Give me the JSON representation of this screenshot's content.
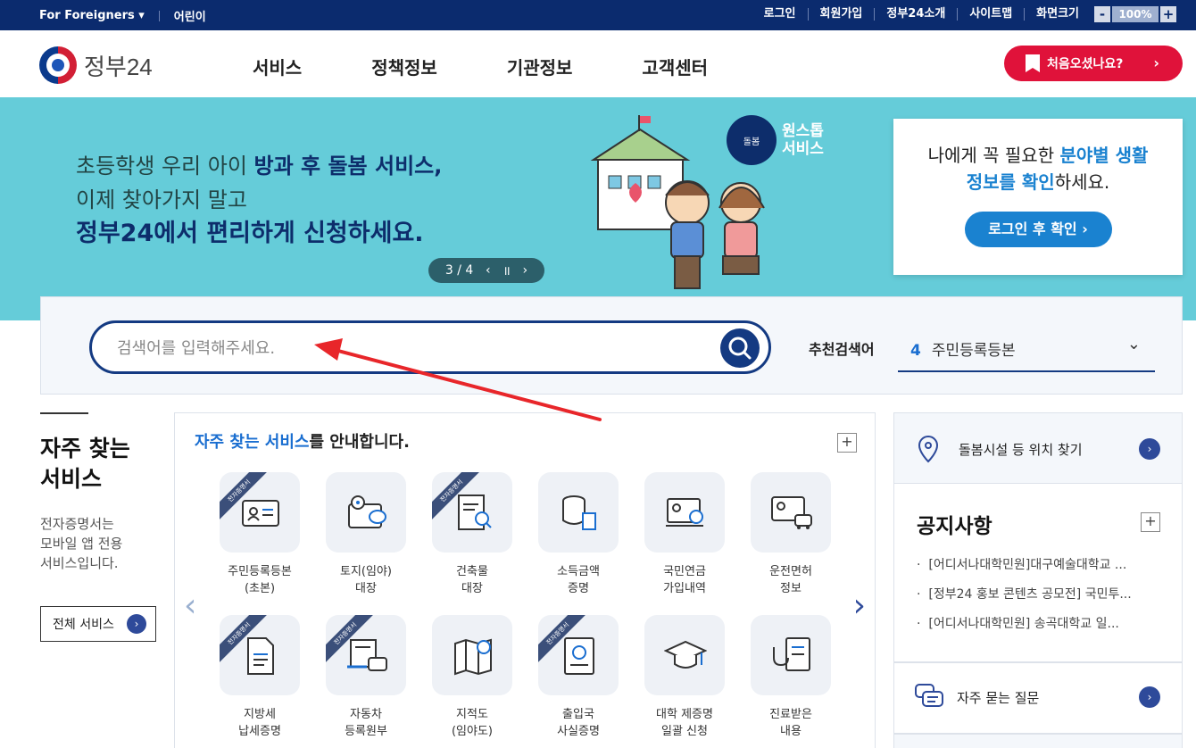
{
  "topbar": {
    "foreigners": "For Foreigners ▾",
    "kids": "어린이",
    "links": [
      "로그인",
      "회원가입",
      "정부24소개",
      "사이트맵",
      "화면크기"
    ],
    "zoom_minus": "-",
    "zoom": "100%",
    "zoom_plus": "+"
  },
  "header": {
    "logo": "정부24",
    "nav": [
      "서비스",
      "정책정보",
      "기관정보",
      "고객센터"
    ],
    "first_visit": "처음오셨나요?"
  },
  "banner": {
    "line1_plain": "초등학생 우리 아이 ",
    "line1_bold": "방과 후 돌봄 서비스,",
    "line2": "이제 찾아가지 말고",
    "line3": "정부24에서 편리하게 신청하세요.",
    "pager": "3 / 4",
    "onestop_badge": "돌봄",
    "onestop_title1": "원스톱",
    "onestop_title2": "서비스"
  },
  "infobox": {
    "text1_plain": "나에게 꼭 필요한 ",
    "text1_hl": "분야별 생활",
    "text2_hl": "정보를 확인",
    "text2_plain": "하세요.",
    "button": "로그인 후 확인 ›"
  },
  "search": {
    "placeholder": "검색어를 입력해주세요.",
    "rec_label": "추천검색어",
    "rec_num": "4",
    "rec_value": "주민등록등본"
  },
  "left": {
    "title1": "자주 찾는",
    "title2": "서비스",
    "desc1": "전자증명서는",
    "desc2": "모바일 앱 전용",
    "desc3": "서비스입니다.",
    "all_button": "전체 서비스"
  },
  "services": {
    "title_hl": "자주 찾는 서비스",
    "title_rest": "를 안내합니다.",
    "ribbon": "전자증명서",
    "items": [
      {
        "l1": "주민등록등본",
        "l2": "(초본)"
      },
      {
        "l1": "토지(임야)",
        "l2": "대장"
      },
      {
        "l1": "건축물",
        "l2": "대장"
      },
      {
        "l1": "소득금액",
        "l2": "증명"
      },
      {
        "l1": "국민연금",
        "l2": "가입내역"
      },
      {
        "l1": "운전면허",
        "l2": "정보"
      },
      {
        "l1": "지방세",
        "l2": "납세증명"
      },
      {
        "l1": "자동차",
        "l2": "등록원부"
      },
      {
        "l1": "지적도",
        "l2": "(임야도)"
      },
      {
        "l1": "출입국",
        "l2": "사실증명"
      },
      {
        "l1": "대학 제증명",
        "l2": "일괄 신청"
      },
      {
        "l1": "진료받은",
        "l2": "내용"
      }
    ]
  },
  "right": {
    "care": "돌봄시설 등 위치 찾기",
    "notice_title": "공지사항",
    "notices": [
      "[어디서나대학민원]대구예술대학교 ...",
      "[정부24 홍보 콘텐츠 공모전] 국민투...",
      "[어디서나대학민원] 송곡대학교 일..."
    ],
    "faq": "자주 묻는 질문"
  },
  "colors": {
    "navy": "#0b2b6e",
    "accent_red": "#e0123a",
    "banner_bg": "#65ccd9",
    "blue": "#1a82d0"
  }
}
